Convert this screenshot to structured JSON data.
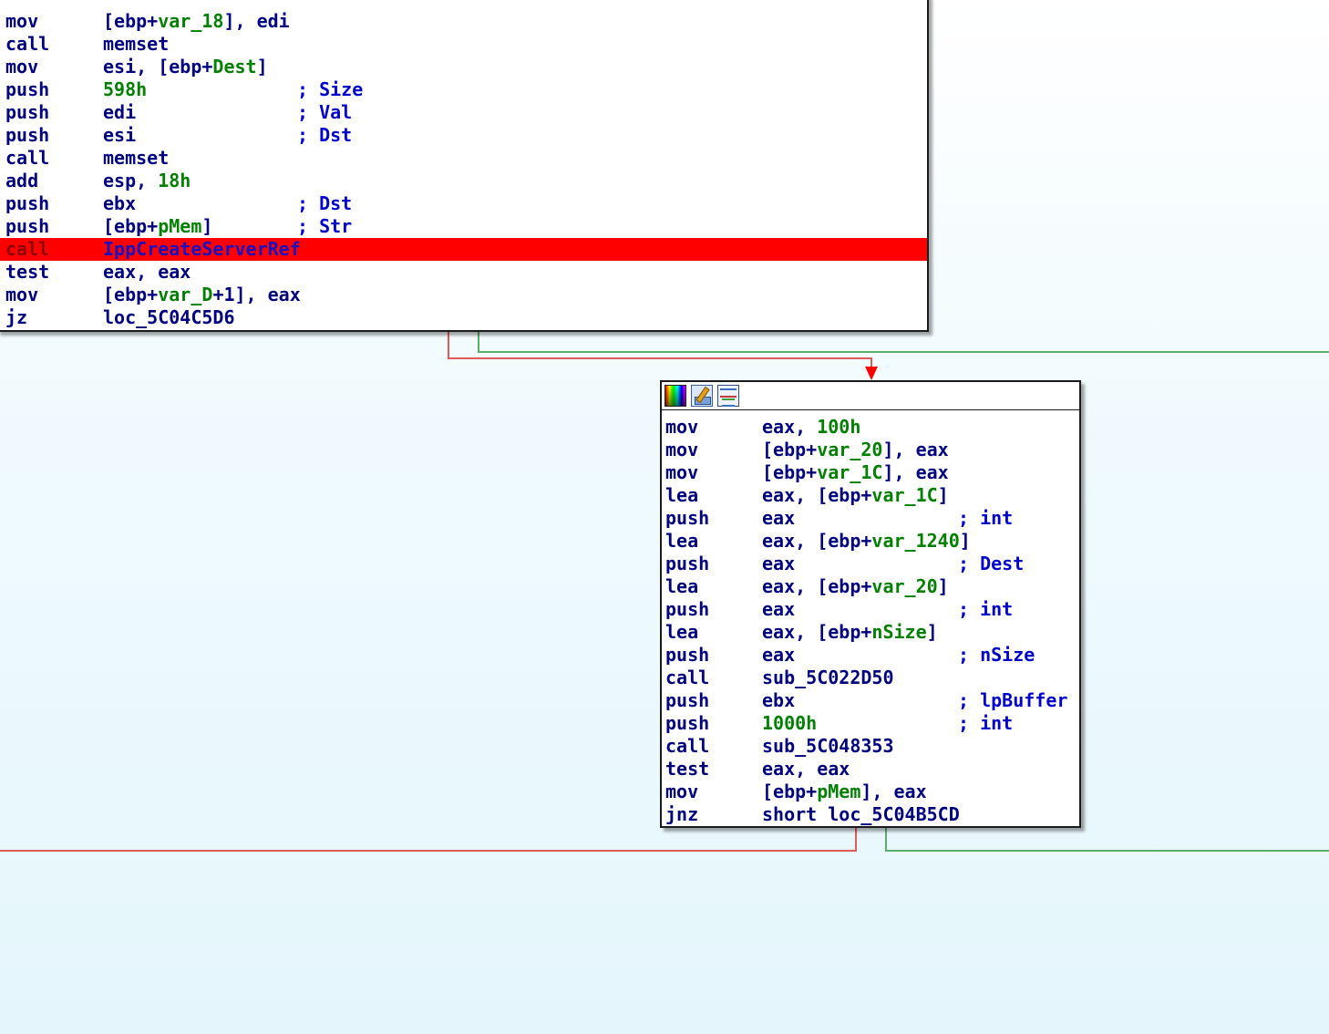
{
  "colors": {
    "edge_false": "#e05a5a",
    "edge_true": "#5aad6a",
    "highlight": "#ff0000",
    "mnemonic": "#00007f",
    "number": "#007f00",
    "comment": "#0000cc"
  },
  "block_a": {
    "lines": [
      {
        "mnemonic": "mov",
        "operand_parts": [
          "[ebp+",
          {
            "t": "var_18"
          },
          "], edi"
        ],
        "comment": ""
      },
      {
        "mnemonic": "call",
        "operand_parts": [
          "memset"
        ],
        "comment": ""
      },
      {
        "mnemonic": "mov",
        "operand_parts": [
          "esi, [ebp+",
          {
            "t": "Dest"
          },
          "]"
        ],
        "comment": ""
      },
      {
        "mnemonic": "push",
        "operand_parts": [
          {
            "t": "598h"
          }
        ],
        "comment": "; Size"
      },
      {
        "mnemonic": "push",
        "operand_parts": [
          "edi"
        ],
        "comment": "; Val"
      },
      {
        "mnemonic": "push",
        "operand_parts": [
          "esi"
        ],
        "comment": "; Dst"
      },
      {
        "mnemonic": "call",
        "operand_parts": [
          "memset"
        ],
        "comment": ""
      },
      {
        "mnemonic": "add",
        "operand_parts": [
          "esp, ",
          {
            "t": "18h"
          }
        ],
        "comment": ""
      },
      {
        "mnemonic": "push",
        "operand_parts": [
          "ebx"
        ],
        "comment": "; Dst"
      },
      {
        "mnemonic": "push",
        "operand_parts": [
          "[ebp+",
          {
            "t": "pMem"
          },
          "]"
        ],
        "comment": "; Str"
      },
      {
        "mnemonic": "call",
        "operand_parts": [
          "IppCreateServerRef"
        ],
        "comment": "",
        "highlighted": true
      },
      {
        "mnemonic": "test",
        "operand_parts": [
          "eax, eax"
        ],
        "comment": ""
      },
      {
        "mnemonic": "mov",
        "operand_parts": [
          "[ebp+",
          {
            "t": "var_D"
          },
          "+1], eax"
        ],
        "comment": ""
      },
      {
        "mnemonic": "jz",
        "operand_parts": [
          "loc_5C04C5D6"
        ],
        "comment": ""
      }
    ]
  },
  "block_b": {
    "header_icons": [
      "colors-icon",
      "rename-icon",
      "graph-overview-icon"
    ],
    "lines": [
      {
        "mnemonic": "mov",
        "operand_parts": [
          "eax, ",
          {
            "t": "100h"
          }
        ],
        "comment": ""
      },
      {
        "mnemonic": "mov",
        "operand_parts": [
          "[ebp+",
          {
            "t": "var_20"
          },
          "], eax"
        ],
        "comment": ""
      },
      {
        "mnemonic": "mov",
        "operand_parts": [
          "[ebp+",
          {
            "t": "var_1C"
          },
          "], eax"
        ],
        "comment": ""
      },
      {
        "mnemonic": "lea",
        "operand_parts": [
          "eax, [ebp+",
          {
            "t": "var_1C"
          },
          "]"
        ],
        "comment": ""
      },
      {
        "mnemonic": "push",
        "operand_parts": [
          "eax"
        ],
        "comment": "; int"
      },
      {
        "mnemonic": "lea",
        "operand_parts": [
          "eax, [ebp+",
          {
            "t": "var_1240"
          },
          "]"
        ],
        "comment": ""
      },
      {
        "mnemonic": "push",
        "operand_parts": [
          "eax"
        ],
        "comment": "; Dest"
      },
      {
        "mnemonic": "lea",
        "operand_parts": [
          "eax, [ebp+",
          {
            "t": "var_20"
          },
          "]"
        ],
        "comment": ""
      },
      {
        "mnemonic": "push",
        "operand_parts": [
          "eax"
        ],
        "comment": "; int"
      },
      {
        "mnemonic": "lea",
        "operand_parts": [
          "eax, [ebp+",
          {
            "t": "nSize"
          },
          "]"
        ],
        "comment": ""
      },
      {
        "mnemonic": "push",
        "operand_parts": [
          "eax"
        ],
        "comment": "; nSize"
      },
      {
        "mnemonic": "call",
        "operand_parts": [
          "sub_5C022D50"
        ],
        "comment": ""
      },
      {
        "mnemonic": "push",
        "operand_parts": [
          "ebx"
        ],
        "comment": "; lpBuffer"
      },
      {
        "mnemonic": "push",
        "operand_parts": [
          {
            "t": "1000h"
          }
        ],
        "comment": "; int"
      },
      {
        "mnemonic": "call",
        "operand_parts": [
          "sub_5C048353"
        ],
        "comment": ""
      },
      {
        "mnemonic": "test",
        "operand_parts": [
          "eax, eax"
        ],
        "comment": ""
      },
      {
        "mnemonic": "mov",
        "operand_parts": [
          "[ebp+",
          {
            "t": "pMem"
          },
          "], eax"
        ],
        "comment": ""
      },
      {
        "mnemonic": "jnz",
        "operand_parts": [
          "short loc_5C04B5CD"
        ],
        "comment": ""
      }
    ]
  }
}
